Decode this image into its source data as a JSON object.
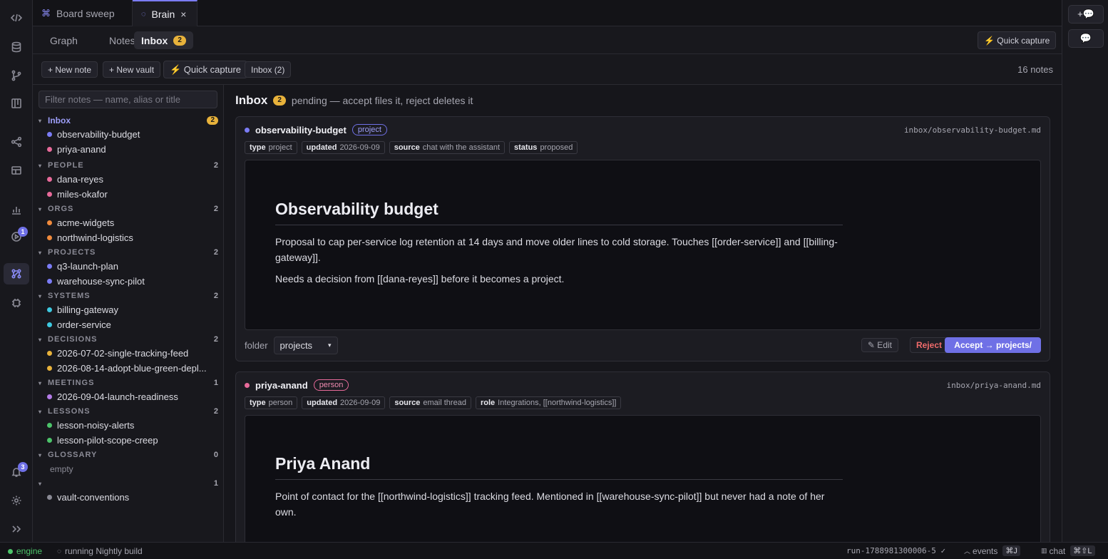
{
  "tabs": [
    {
      "label": "Board sweep",
      "icon": "command-icon"
    },
    {
      "label": "Brain",
      "icon": "brain-icon",
      "close": "×"
    }
  ],
  "subnav": {
    "items": [
      "Graph",
      "Notes",
      "Inbox"
    ],
    "inbox_count": "2",
    "quick_capture": "⚡ Quick capture"
  },
  "toolbar": {
    "new_note": "+ New note",
    "new_vault": "+ New vault",
    "quick_capture": "⚡ Quick capture",
    "inbox": "Inbox (2)",
    "notes_count": "16 notes"
  },
  "sidebar": {
    "filter_placeholder": "Filter notes — name, alias or title",
    "inbox": {
      "label": "Inbox",
      "count": "2",
      "items": [
        {
          "name": "observability-budget",
          "color": "#7b7cf5"
        },
        {
          "name": "priya-anand",
          "color": "#e86a9a"
        }
      ]
    },
    "groups": [
      {
        "label": "PEOPLE",
        "count": "2",
        "items": [
          {
            "name": "dana-reyes",
            "color": "#e86a9a"
          },
          {
            "name": "miles-okafor",
            "color": "#e86a9a"
          }
        ]
      },
      {
        "label": "ORGS",
        "count": "2",
        "items": [
          {
            "name": "acme-widgets",
            "color": "#f08a3c"
          },
          {
            "name": "northwind-logistics",
            "color": "#f08a3c"
          }
        ]
      },
      {
        "label": "PROJECTS",
        "count": "2",
        "items": [
          {
            "name": "q3-launch-plan",
            "color": "#7b7cf5"
          },
          {
            "name": "warehouse-sync-pilot",
            "color": "#7b7cf5"
          }
        ]
      },
      {
        "label": "SYSTEMS",
        "count": "2",
        "items": [
          {
            "name": "billing-gateway",
            "color": "#3ec9e0"
          },
          {
            "name": "order-service",
            "color": "#3ec9e0"
          }
        ]
      },
      {
        "label": "DECISIONS",
        "count": "2",
        "items": [
          {
            "name": "2026-07-02-single-tracking-feed",
            "color": "#e8b23b"
          },
          {
            "name": "2026-08-14-adopt-blue-green-depl...",
            "color": "#e8b23b"
          }
        ]
      },
      {
        "label": "MEETINGS",
        "count": "1",
        "items": [
          {
            "name": "2026-09-04-launch-readiness",
            "color": "#b47ce8"
          }
        ]
      },
      {
        "label": "LESSONS",
        "count": "2",
        "items": [
          {
            "name": "lesson-noisy-alerts",
            "color": "#4cc46a"
          },
          {
            "name": "lesson-pilot-scope-creep",
            "color": "#4cc46a"
          }
        ]
      },
      {
        "label": "GLOSSARY",
        "count": "0",
        "empty": "empty",
        "items": []
      },
      {
        "label": "",
        "count": "1",
        "items": [
          {
            "name": "vault-conventions",
            "color": "#8a8a95"
          }
        ]
      }
    ]
  },
  "main": {
    "title": "Inbox",
    "count": "2",
    "subtitle": "pending — accept files it, reject deletes it",
    "cards": [
      {
        "name": "observability-budget",
        "dot": "#7b7cf5",
        "tag": "project",
        "path": "inbox/observability-budget.md",
        "meta": [
          {
            "k": "type",
            "v": "project"
          },
          {
            "k": "updated",
            "v": "2026-09-09"
          },
          {
            "k": "source",
            "v": "chat with the assistant"
          },
          {
            "k": "status",
            "v": "proposed"
          }
        ],
        "heading": "Observability budget",
        "paras": [
          "Proposal to cap per-service log retention at 14 days and move older lines to cold storage. Touches [[order-service]] and [[billing-gateway]].",
          "Needs a decision from [[dana-reyes]] before it becomes a project."
        ],
        "folder_label": "folder",
        "folder_value": "projects",
        "edit": "✎ Edit",
        "reject": "Reject",
        "accept": "Accept → projects/"
      },
      {
        "name": "priya-anand",
        "dot": "#e86a9a",
        "tag": "person",
        "path": "inbox/priya-anand.md",
        "meta": [
          {
            "k": "type",
            "v": "person"
          },
          {
            "k": "updated",
            "v": "2026-09-09"
          },
          {
            "k": "source",
            "v": "email thread"
          },
          {
            "k": "role",
            "v": "Integrations, [[northwind-logistics]]"
          }
        ],
        "heading": "Priya Anand",
        "paras": [
          "Point of contact for the [[northwind-logistics]] tracking feed. Mentioned in [[warehouse-sync-pilot]] but never had a note of her own."
        ]
      }
    ]
  },
  "rail": {
    "badges": {
      "runs": "1",
      "notifications": "3"
    }
  },
  "status": {
    "engine": "engine",
    "running": "running Nightly build",
    "run_id": "run-1788981300006-5 ✓",
    "events": "events",
    "events_kbd": "⌘J",
    "chat": "chat",
    "chat_kbd": "⌘⇧L"
  }
}
